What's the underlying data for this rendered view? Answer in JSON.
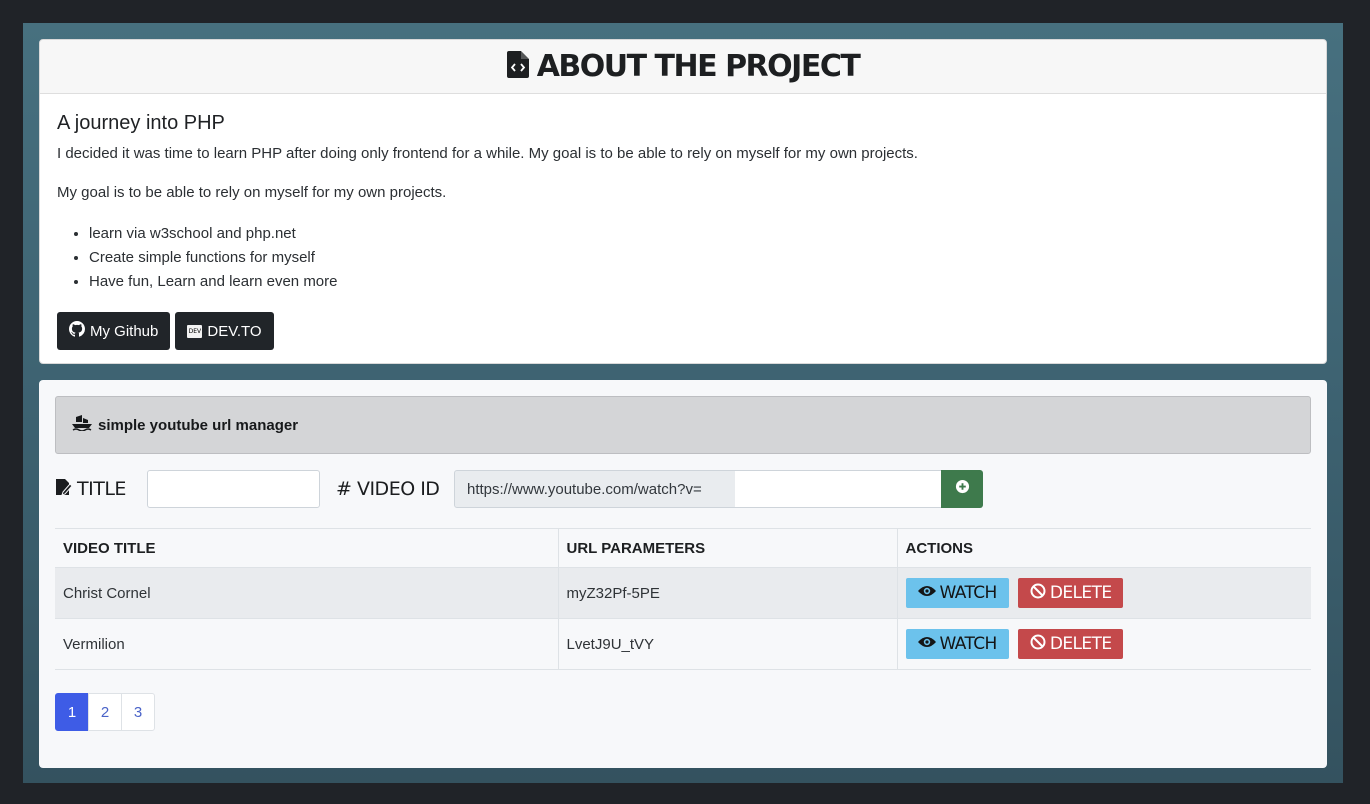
{
  "about": {
    "header_title": "ABOUT THE PROJECT",
    "heading": "A journey into PHP",
    "paragraph_1": "I decided it was time to learn PHP after doing only frontend for a while. My goal is to be able to rely on myself for my own projects.",
    "paragraph_2": "My goal is to be able to rely on myself for my own projects.",
    "bullets": [
      "learn via w3school and php.net",
      "Create simple functions for myself",
      "Have fun, Learn and learn even more"
    ],
    "github_label": "My Github",
    "devto_label": "DEV.TO",
    "devto_badge": "DEV"
  },
  "manager": {
    "title": "simple youtube url manager",
    "title_label": "TITLE",
    "video_id_label": "# VIDEO ID",
    "title_value": "",
    "url_prefix": "https://www.youtube.com/watch?v=",
    "video_id_value": ""
  },
  "table": {
    "headers": [
      "VIDEO TITLE",
      "URL PARAMETERS",
      "ACTIONS"
    ],
    "rows": [
      {
        "title": "Christ Cornel",
        "param": "myZ32Pf-5PE"
      },
      {
        "title": "Vermilion",
        "param": "LvetJ9U_tVY"
      }
    ],
    "watch_label": "WATCH",
    "delete_label": "DELETE"
  },
  "pagination": {
    "pages": [
      "1",
      "2",
      "3"
    ],
    "active": "1"
  },
  "colors": {
    "watch": "#6cc2ec",
    "delete": "#c4494b",
    "add": "#3e7a4c",
    "active_page": "#3e5ce6"
  }
}
